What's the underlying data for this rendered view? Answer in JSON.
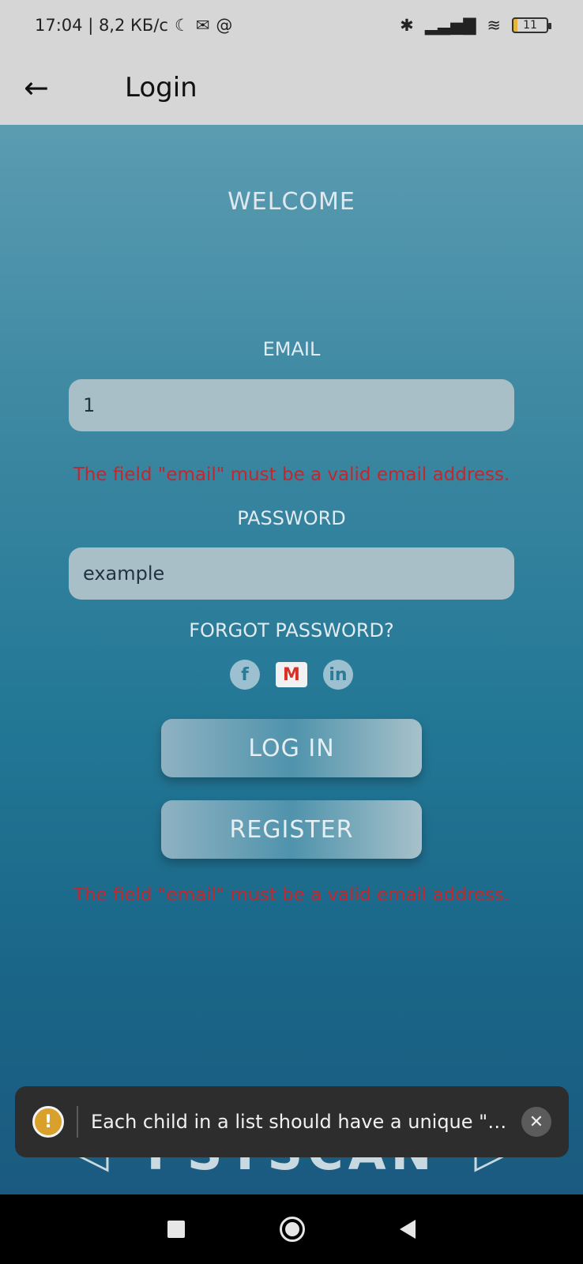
{
  "status_bar": {
    "time_speed": "17:04 | 8,2 КБ/с",
    "battery": "11"
  },
  "app_bar": {
    "title": "Login"
  },
  "login": {
    "welcome": "WELCOME",
    "email_label": "EMAIL",
    "email_value": "1",
    "email_error": "The field \"email\" must be a valid email address.",
    "password_label": "PASSWORD",
    "password_value": "example",
    "forgot_label": "FORGOT PASSWORD?",
    "login_label": "LOG IN",
    "register_label": "REGISTER",
    "form_error": "The field \"email\" must be a valid email address.",
    "brand": "PSYSCAN"
  },
  "toast": {
    "message": "Each child in a list should have a unique \"ke..."
  }
}
